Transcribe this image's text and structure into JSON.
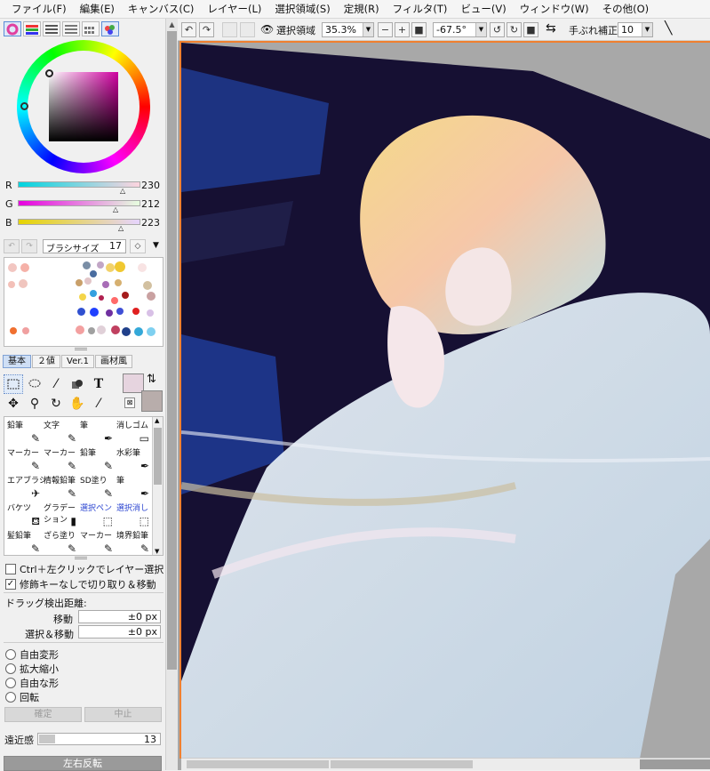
{
  "menu": [
    "ファイル(F)",
    "編集(E)",
    "キャンバス(C)",
    "レイヤー(L)",
    "選択領域(S)",
    "定規(R)",
    "フィルタ(T)",
    "ビュー(V)",
    "ウィンドウ(W)",
    "その他(O)"
  ],
  "color": {
    "r_label": "R",
    "r_value": "230",
    "g_label": "G",
    "g_value": "212",
    "b_label": "B",
    "b_value": "223",
    "foreground": "#e6d4df",
    "background": "#b8adab"
  },
  "brush_size": {
    "label": "ブラシサイズ",
    "value": "17"
  },
  "tool_tabs": [
    "基本",
    "２値",
    "Ver.1",
    "画材風"
  ],
  "brushes": [
    {
      "name": "鉛筆",
      "icon": "✎",
      "blue": false
    },
    {
      "name": "文字",
      "icon": "✎",
      "blue": false
    },
    {
      "name": "筆",
      "icon": "✒",
      "blue": false
    },
    {
      "name": "消しゴム",
      "icon": "▭",
      "blue": false
    },
    {
      "name": "マーカー",
      "icon": "✎",
      "blue": false
    },
    {
      "name": "マーカー",
      "icon": "✎",
      "blue": false
    },
    {
      "name": "鉛筆",
      "icon": "✎",
      "blue": false
    },
    {
      "name": "水彩筆",
      "icon": "✒",
      "blue": false
    },
    {
      "name": "エアブラシ",
      "icon": "✈",
      "blue": false
    },
    {
      "name": "情報鉛筆",
      "icon": "✎",
      "blue": false
    },
    {
      "name": "SD塗り",
      "icon": "✎",
      "blue": false
    },
    {
      "name": "筆",
      "icon": "✒",
      "blue": false
    },
    {
      "name": "バケツ",
      "icon": "⛾",
      "blue": false
    },
    {
      "name": "グラデー\nション",
      "icon": "▮",
      "blue": false
    },
    {
      "name": "選択ペン",
      "icon": "⬚",
      "blue": true
    },
    {
      "name": "選択消し",
      "icon": "⬚",
      "blue": true
    },
    {
      "name": "髪鉛筆",
      "icon": "✎",
      "blue": false
    },
    {
      "name": "ざら塗り",
      "icon": "✎",
      "blue": false
    },
    {
      "name": "マーカー",
      "icon": "✎",
      "blue": false
    },
    {
      "name": "境界鉛筆",
      "icon": "✎",
      "blue": false
    }
  ],
  "options": {
    "ctrl_click": "Ctrl＋左クリックでレイヤー選択",
    "no_modifier": "修飾キーなしで切り取り＆移動",
    "drag_distance": "ドラッグ検出距離:",
    "move_label": "移動",
    "move_value": "±0 px",
    "select_move_label": "選択＆移動",
    "select_move_value": "±0 px"
  },
  "transform": {
    "free": "自由変形",
    "scale": "拡大縮小",
    "free_shape": "自由な形",
    "rotate": "回転",
    "confirm": "確定",
    "cancel": "中止"
  },
  "perspective": {
    "label": "遠近感",
    "value": "13",
    "fraction": 0.13
  },
  "flip_button": "左右反転",
  "toolbar": {
    "selection_label": "選択領域",
    "zoom": "35.3%",
    "rotation": "-67.5°",
    "stabilizer_label": "手ぶれ補正",
    "stabilizer_value": "10"
  }
}
